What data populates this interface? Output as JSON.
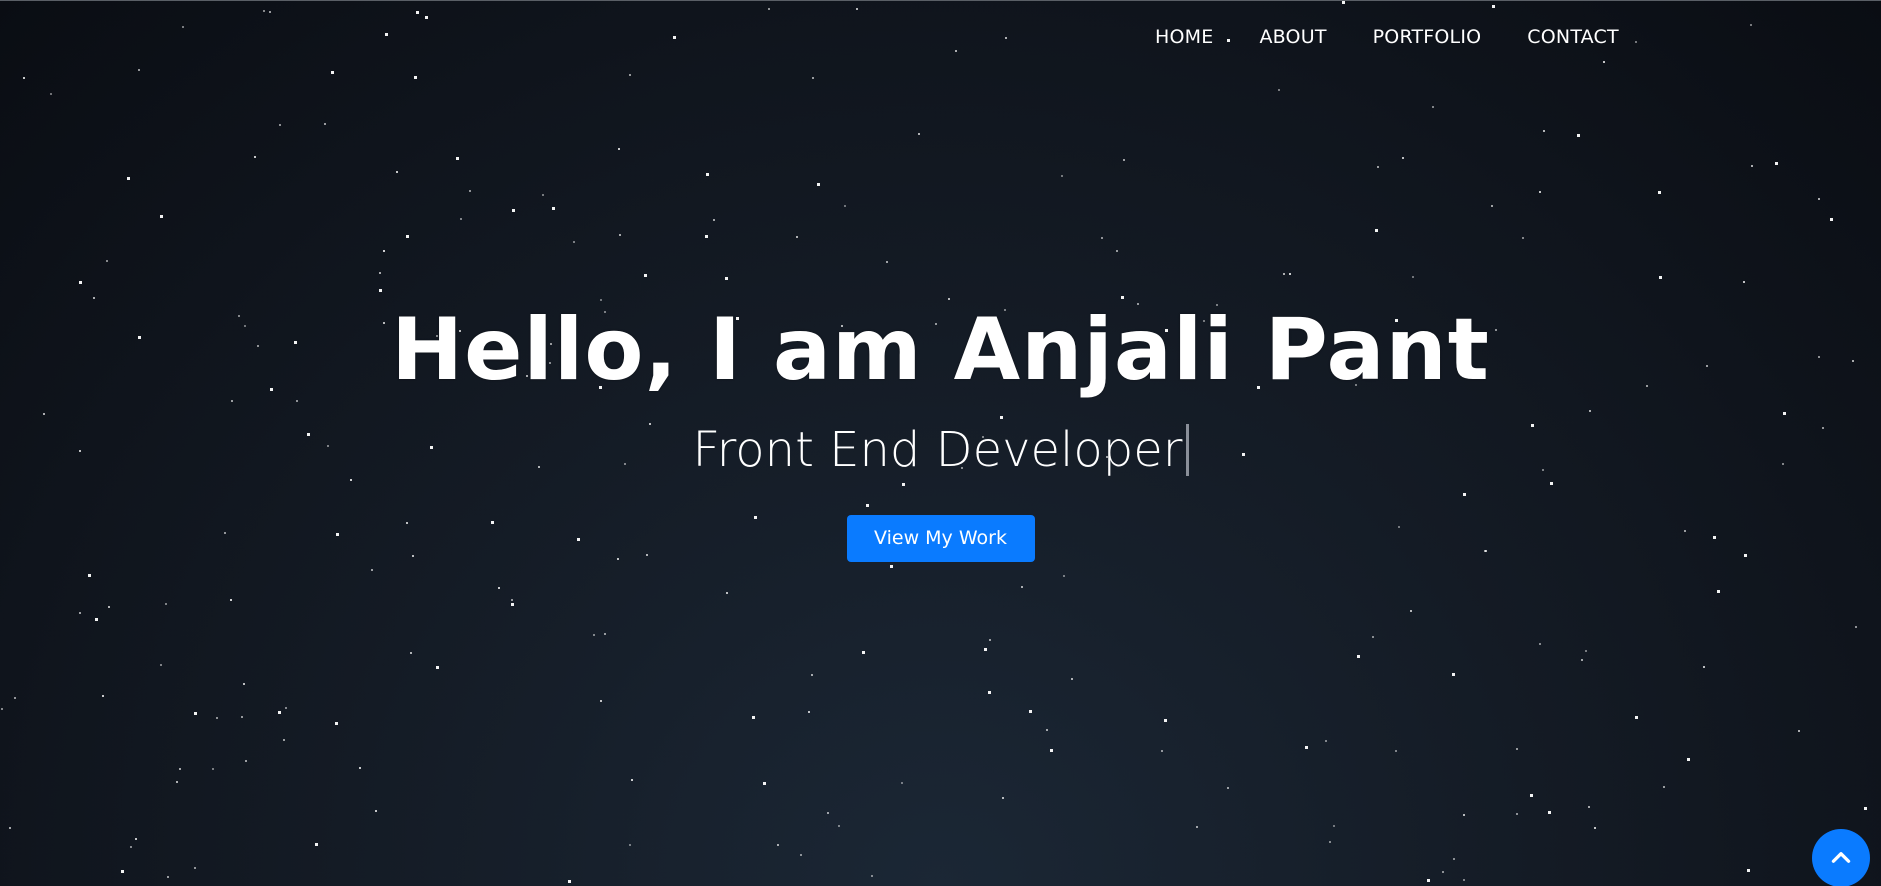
{
  "nav": {
    "items": [
      {
        "label": "HOME"
      },
      {
        "label": "ABOUT"
      },
      {
        "label": "PORTFOLIO"
      },
      {
        "label": "CONTACT"
      }
    ]
  },
  "hero": {
    "title": "Hello, I am Anjali Pant",
    "subtitle": "Front End Developer",
    "cta_label": "View My Work"
  },
  "scroll_top": {
    "icon": "chevron-up-icon"
  },
  "colors": {
    "accent": "#0a7bff",
    "background_dark": "#0a0d13",
    "background_light": "#1b2735",
    "text": "#ffffff"
  }
}
